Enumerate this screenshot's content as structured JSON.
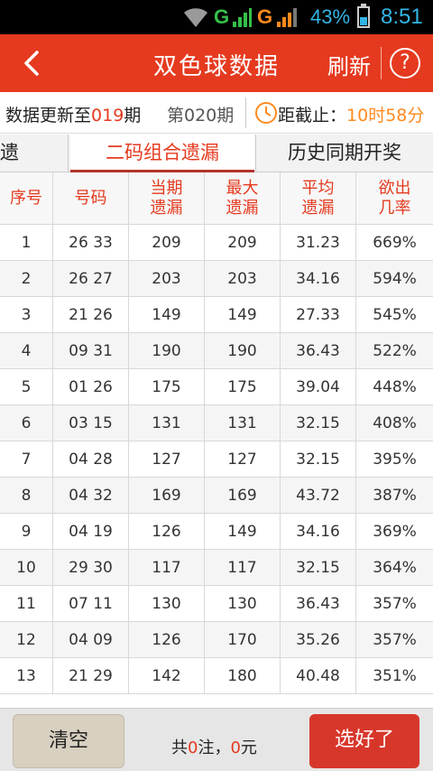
{
  "status_bar": {
    "net1": "G",
    "net2": "G",
    "battery": "43%",
    "battery_level": 0.43,
    "time": "8:51"
  },
  "header": {
    "title": "双色球数据",
    "refresh_label": "刷新",
    "help_label": "?"
  },
  "info": {
    "update_prefix": "数据更新至",
    "update_issue": "019",
    "update_suffix": "期",
    "current_issue": "第020期",
    "deadline_prefix": "距截止：",
    "deadline_value": "10时58分"
  },
  "tabs": [
    {
      "label": "遗漏"
    },
    {
      "label": "二码组合遗漏"
    },
    {
      "label": "历史同期开奖"
    }
  ],
  "table": {
    "headers": [
      "序号",
      "号码",
      "当期\n遗漏",
      "最大\n遗漏",
      "平均\n遗漏",
      "欲出\n几率"
    ],
    "rows": [
      [
        "1",
        "26 33",
        "209",
        "209",
        "31.23",
        "669%"
      ],
      [
        "2",
        "26 27",
        "203",
        "203",
        "34.16",
        "594%"
      ],
      [
        "3",
        "21 26",
        "149",
        "149",
        "27.33",
        "545%"
      ],
      [
        "4",
        "09 31",
        "190",
        "190",
        "36.43",
        "522%"
      ],
      [
        "5",
        "01 26",
        "175",
        "175",
        "39.04",
        "448%"
      ],
      [
        "6",
        "03 15",
        "131",
        "131",
        "32.15",
        "408%"
      ],
      [
        "7",
        "04 28",
        "127",
        "127",
        "32.15",
        "395%"
      ],
      [
        "8",
        "04 32",
        "169",
        "169",
        "43.72",
        "387%"
      ],
      [
        "9",
        "04 19",
        "126",
        "149",
        "34.16",
        "369%"
      ],
      [
        "10",
        "29 30",
        "117",
        "117",
        "32.15",
        "364%"
      ],
      [
        "11",
        "07 11",
        "130",
        "130",
        "36.43",
        "357%"
      ],
      [
        "12",
        "04 09",
        "126",
        "170",
        "35.26",
        "357%"
      ],
      [
        "13",
        "21 29",
        "142",
        "180",
        "40.48",
        "351%"
      ]
    ]
  },
  "bottom": {
    "clear_label": "清空",
    "summary_prefix": "共",
    "count": "0",
    "summary_mid": "注，",
    "amount": "0",
    "summary_suffix": "元",
    "select_label": "选好了"
  }
}
